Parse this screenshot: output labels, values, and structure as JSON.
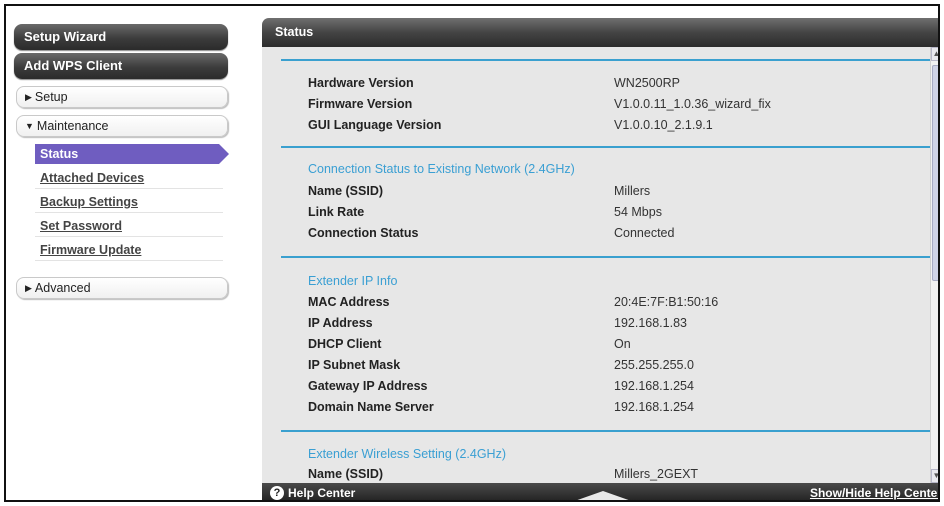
{
  "sidebar": {
    "setup_wizard": "Setup Wizard",
    "add_wps_client": "Add WPS Client",
    "setup": "Setup",
    "maintenance": "Maintenance",
    "maintenance_items": [
      "Status",
      "Attached Devices",
      "Backup Settings",
      "Set Password",
      "Firmware Update"
    ],
    "advanced": "Advanced",
    "collapsed_glyph": "▶",
    "expanded_glyph": "▼"
  },
  "main": {
    "title": "Status",
    "device": [
      {
        "label": "Hardware Version",
        "value": "WN2500RP"
      },
      {
        "label": "Firmware Version",
        "value": "V1.0.0.11_1.0.36_wizard_fix"
      },
      {
        "label": "GUI Language Version",
        "value": "V1.0.0.10_2.1.9.1"
      }
    ],
    "connection": {
      "title": "Connection Status to Existing Network (2.4GHz)",
      "rows": [
        {
          "label": "Name (SSID)",
          "value": "Millers"
        },
        {
          "label": "Link Rate",
          "value": "54 Mbps"
        },
        {
          "label": "Connection Status",
          "value": "Connected"
        }
      ]
    },
    "ip": {
      "title": "Extender IP Info",
      "rows": [
        {
          "label": "MAC Address",
          "value": "20:4E:7F:B1:50:16"
        },
        {
          "label": "IP Address",
          "value": "192.168.1.83"
        },
        {
          "label": "DHCP Client",
          "value": "On"
        },
        {
          "label": "IP Subnet Mask",
          "value": "255.255.255.0"
        },
        {
          "label": "Gateway IP Address",
          "value": "192.168.1.254"
        },
        {
          "label": "Domain Name Server",
          "value": "192.168.1.254"
        }
      ]
    },
    "wireless": {
      "title": "Extender Wireless Setting (2.4GHz)",
      "rows": [
        {
          "label": "Name (SSID)",
          "value": "Millers_2GEXT"
        }
      ]
    }
  },
  "footer": {
    "help_icon_glyph": "?",
    "help_center": "Help Center",
    "show_hide": "Show/Hide Help Center"
  },
  "scrollbar": {
    "up_glyph": "▲",
    "down_glyph": "▼"
  },
  "colors": {
    "accent": "#3aa0cf",
    "active_nav": "#6f5dc0"
  }
}
